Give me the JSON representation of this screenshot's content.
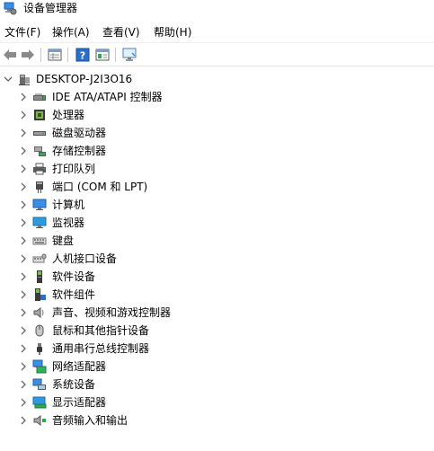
{
  "window": {
    "title": "设备管理器"
  },
  "menu": [
    {
      "label": "文件(F)"
    },
    {
      "label": "操作(A)"
    },
    {
      "label": "查看(V)"
    },
    {
      "label": "帮助(H)"
    }
  ],
  "toolbar": {
    "buttons": [
      "back-arrow-icon",
      "forward-arrow-icon",
      "properties-grid-icon",
      "help-icon",
      "console-tree-icon",
      "monitor-scan-icon"
    ]
  },
  "tree": {
    "root": {
      "label": "DESKTOP-J2I3O16",
      "icon": "computer-tower-icon",
      "expanded": true
    },
    "children": [
      {
        "label": "IDE ATA/ATAPI 控制器",
        "icon": "ide-controller-icon"
      },
      {
        "label": "处理器",
        "icon": "processor-icon"
      },
      {
        "label": "磁盘驱动器",
        "icon": "disk-drive-icon"
      },
      {
        "label": "存储控制器",
        "icon": "storage-controller-icon"
      },
      {
        "label": "打印队列",
        "icon": "printer-icon"
      },
      {
        "label": "端口 (COM 和 LPT)",
        "icon": "port-icon"
      },
      {
        "label": "计算机",
        "icon": "computer-icon"
      },
      {
        "label": "监视器",
        "icon": "monitor-icon"
      },
      {
        "label": "键盘",
        "icon": "keyboard-icon"
      },
      {
        "label": "人机接口设备",
        "icon": "hid-icon"
      },
      {
        "label": "软件设备",
        "icon": "software-device-icon"
      },
      {
        "label": "软件组件",
        "icon": "software-component-icon"
      },
      {
        "label": "声音、视频和游戏控制器",
        "icon": "speaker-icon"
      },
      {
        "label": "鼠标和其他指针设备",
        "icon": "mouse-icon"
      },
      {
        "label": "通用串行总线控制器",
        "icon": "usb-icon"
      },
      {
        "label": "网络适配器",
        "icon": "network-adapter-icon"
      },
      {
        "label": "系统设备",
        "icon": "system-device-icon"
      },
      {
        "label": "显示适配器",
        "icon": "display-adapter-icon"
      },
      {
        "label": "音频输入和输出",
        "icon": "audio-io-icon"
      }
    ]
  },
  "colors": {
    "accent": "#1e6fd9",
    "chevron": "#666666",
    "toolbar_separator": "#c8c8c8"
  }
}
